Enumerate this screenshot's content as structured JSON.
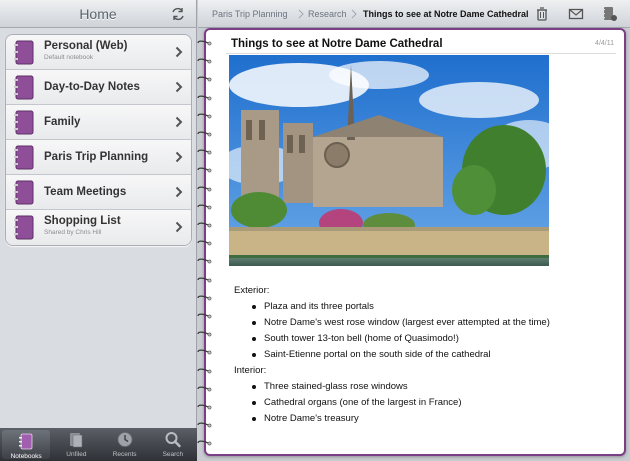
{
  "sidebar": {
    "title": "Home",
    "notebooks": [
      {
        "name": "Personal (Web)",
        "subtitle": "Default notebook"
      },
      {
        "name": "Day-to-Day Notes",
        "subtitle": ""
      },
      {
        "name": "Family",
        "subtitle": ""
      },
      {
        "name": "Paris Trip Planning",
        "subtitle": ""
      },
      {
        "name": "Team Meetings",
        "subtitle": ""
      },
      {
        "name": "Shopping List",
        "subtitle": "Shared by Chris Hill"
      }
    ],
    "tabs": [
      {
        "label": "Notebooks",
        "icon": "notebooks-icon"
      },
      {
        "label": "Unfiled",
        "icon": "unfiled-icon"
      },
      {
        "label": "Recents",
        "icon": "recents-icon"
      },
      {
        "label": "Search",
        "icon": "search-icon"
      }
    ]
  },
  "breadcrumb": [
    "Paris Trip Planning",
    "Research",
    "Things to see at Notre Dame Cathedral"
  ],
  "toolbar": {
    "icons": [
      "trash-icon",
      "email-icon",
      "notebook-settings-icon"
    ]
  },
  "note": {
    "title": "Things to see at Notre Dame Cathedral",
    "date": "4/4/11",
    "image_subject": "Notre Dame Cathedral photo",
    "sections": [
      {
        "heading": "Exterior:",
        "items": [
          "Plaza and its three portals",
          "Notre Dame's west rose window (largest ever attempted at the time)",
          "South tower 13-ton bell (home of Quasimodo!)",
          "Saint-Etienne portal on the south side of the cathedral"
        ]
      },
      {
        "heading": "Interior:",
        "items": [
          "Three stained-glass rose windows",
          "Cathedral organs (one of the largest in France)",
          "Notre Dame's treasury"
        ]
      }
    ]
  },
  "colors": {
    "accent": "#7b3f86",
    "notebook_icon": "#8e4f98"
  }
}
